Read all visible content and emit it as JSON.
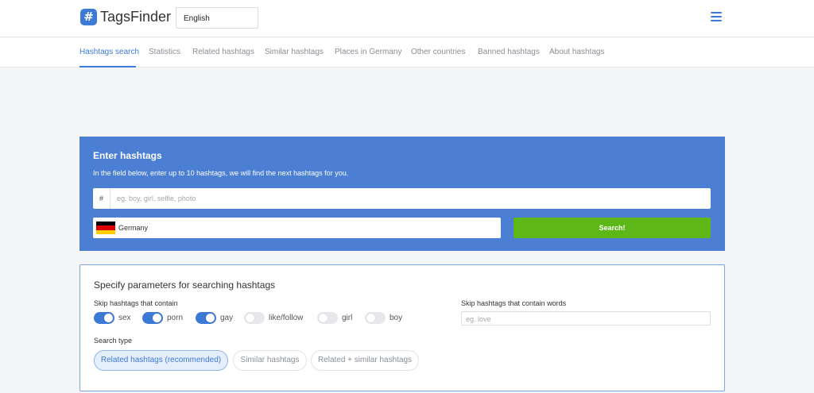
{
  "header": {
    "logo_symbol": "#",
    "logo_text": "TagsFinder",
    "language": "English",
    "menu_icon": "hamburger-icon",
    "brand_color": "#3d7ad6"
  },
  "nav": {
    "items": [
      {
        "label": "Hashtags search",
        "active": true
      },
      {
        "label": "Statistics"
      },
      {
        "label": "Related hashtags"
      },
      {
        "label": "Similar hashtags"
      },
      {
        "label": "Places in Germany"
      },
      {
        "label": "Other countries"
      },
      {
        "label": "Banned hashtags"
      },
      {
        "label": "About hashtags"
      }
    ]
  },
  "hero": {
    "title": "Enter hashtags",
    "subtitle": "In the field below, enter up to 10 hashtags, we will find the next hashtags for you.",
    "hash_prefix": "#",
    "hashtags_placeholder": "eg. boy, girl, selfie, photo",
    "country": "Germany",
    "search_label": "Search!",
    "background_color": "#4a7fd4",
    "search_color": "#5cb816"
  },
  "params": {
    "title": "Specify parameters for searching hashtags",
    "skip_label": "Skip hashtags that contain",
    "toggles": [
      {
        "label": "sex",
        "on": true
      },
      {
        "label": "porn",
        "on": true
      },
      {
        "label": "gay",
        "on": true
      },
      {
        "label": "like/follow",
        "on": false
      },
      {
        "label": "girl",
        "on": false
      },
      {
        "label": "boy",
        "on": false
      }
    ],
    "words_label": "Skip hashtags that contain words",
    "words_placeholder": "eg. love",
    "search_type_label": "Search type",
    "search_types": [
      {
        "label": "Related hashtags (recommended)",
        "active": true
      },
      {
        "label": "Similar hashtags"
      },
      {
        "label": "Related + similar hashtags"
      }
    ]
  }
}
